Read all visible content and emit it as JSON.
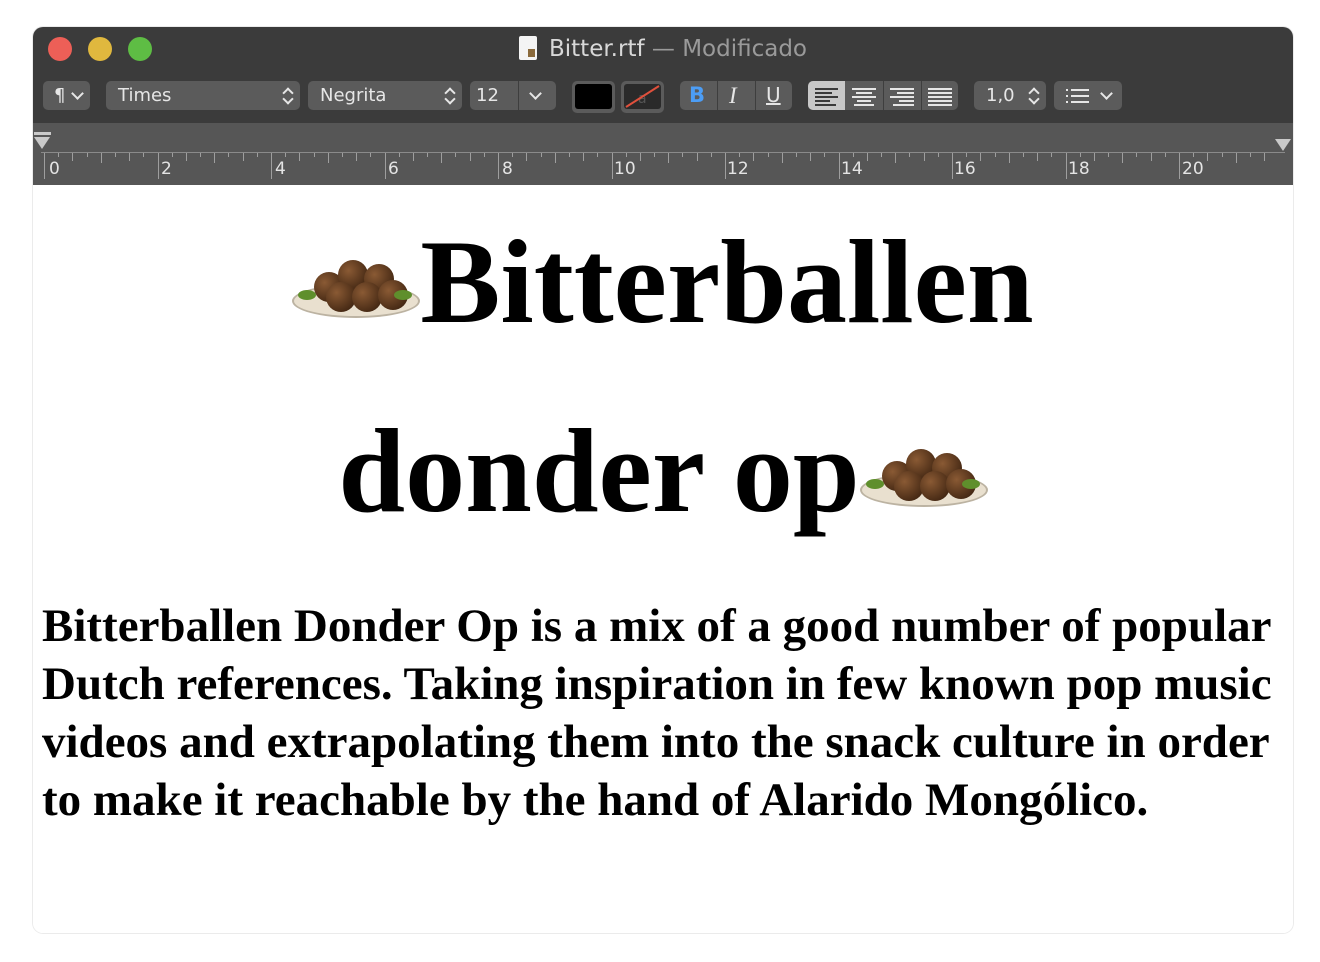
{
  "window": {
    "filename": "Bitter.rtf",
    "separator": "—",
    "status": "Modificado"
  },
  "toolbar": {
    "paragraph_style": "¶",
    "font_family": "Times",
    "font_style": "Negrita",
    "font_size": "12",
    "text_color": "#000000",
    "bold_label": "B",
    "italic_label": "I",
    "underline_label": "U",
    "line_spacing": "1,0",
    "icons": [
      "paragraph-icon",
      "align-left-icon",
      "align-center-icon",
      "align-right-icon",
      "justify-icon",
      "list-icon"
    ]
  },
  "ruler": {
    "numbers": [
      "0",
      "2",
      "4",
      "6",
      "8",
      "10",
      "12",
      "14",
      "16",
      "18",
      "20"
    ]
  },
  "document": {
    "heading_line1": "Bitterballen",
    "heading_line2": "donder op",
    "emoji": "falafel-plate-emoji",
    "body": "Bitterballen Donder Op is a mix of a good number of popular Dutch references. Taking inspiration in few known pop music videos and extrapolating them into the snack culture in order to make it reachable by the hand of Alarido Mongólico."
  },
  "colors": {
    "titlebar": "#3b3b3b",
    "toolbar_control": "#5b5b5b",
    "bold_active": "#4c9df5",
    "close": "#ed5f57",
    "minimize": "#e0b83e",
    "maximize": "#5ebd44"
  }
}
